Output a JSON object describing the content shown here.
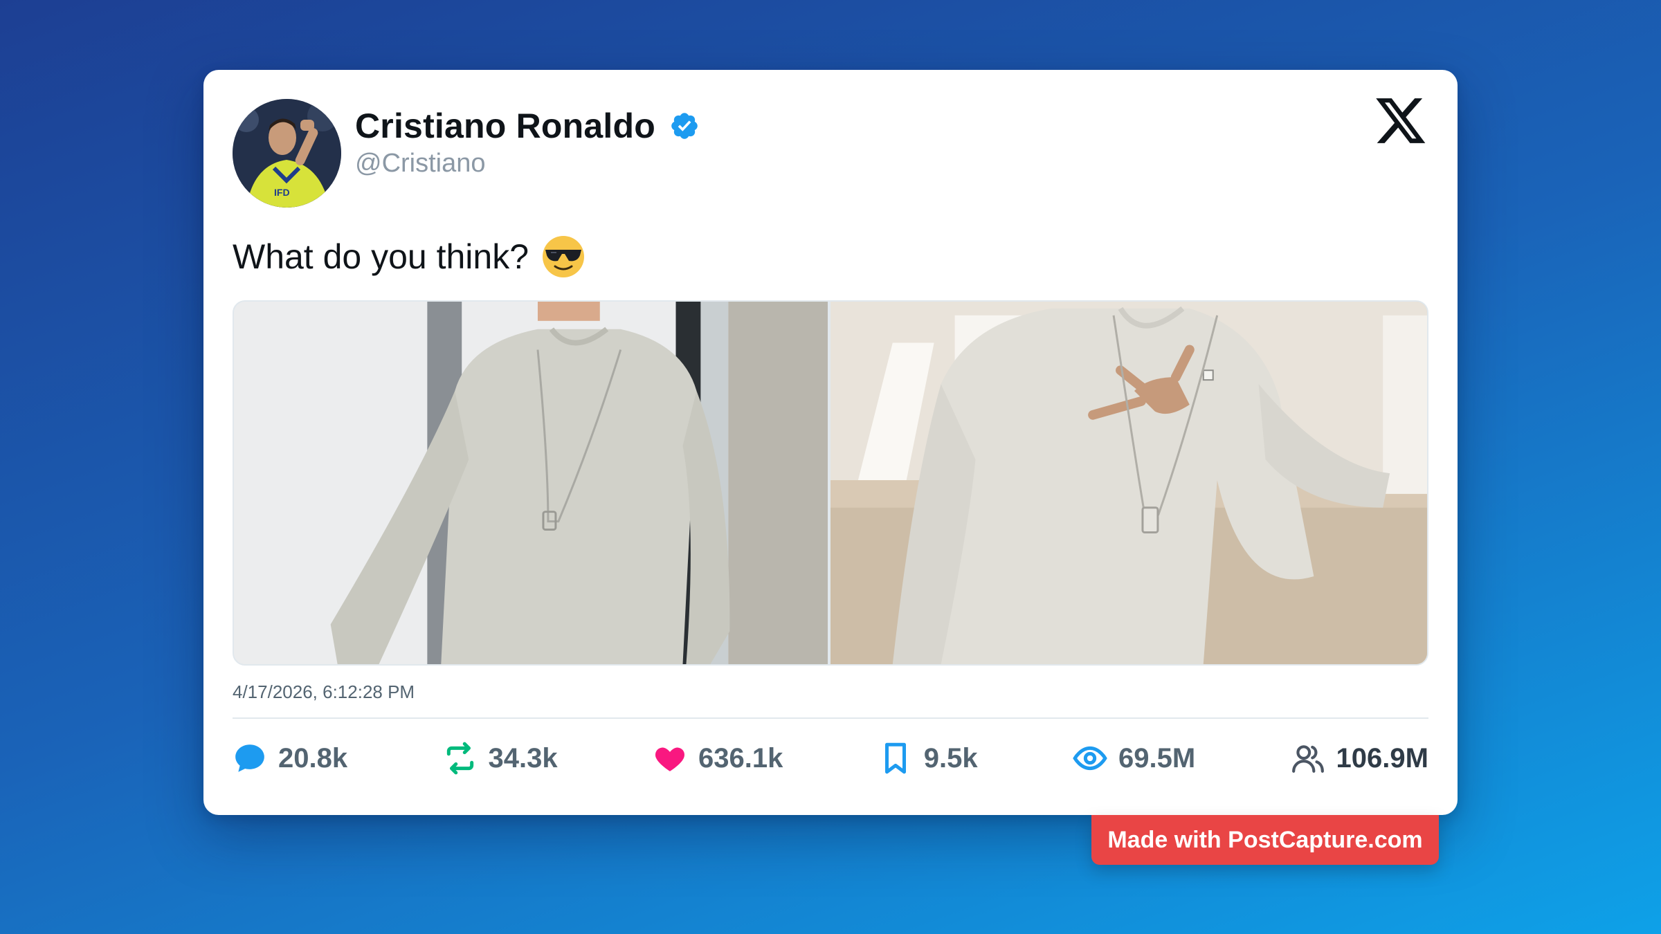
{
  "post": {
    "author_name": "Cristiano Ronaldo",
    "handle": "@Cristiano",
    "text": "What do you think?",
    "emoji_icon": "smiling-face-with-sunglasses",
    "platform_icon": "x-logo-icon",
    "verified": true,
    "timestamp": "4/17/2026, 6:12:28 PM",
    "images_count": 2
  },
  "stats": {
    "replies": "20.8k",
    "reposts": "34.3k",
    "likes": "636.1k",
    "bookmarks": "9.5k",
    "views": "69.5M",
    "followers": "106.9M"
  },
  "colors": {
    "verified": "#1d9bf0",
    "reply": "#1d9bf0",
    "repost": "#00ba7c",
    "like": "#f91880",
    "bookmark": "#1d9bf0",
    "views": "#1d9bf0",
    "badge": "#e94545"
  },
  "footer": {
    "watermark": "Made with PostCapture.com"
  }
}
